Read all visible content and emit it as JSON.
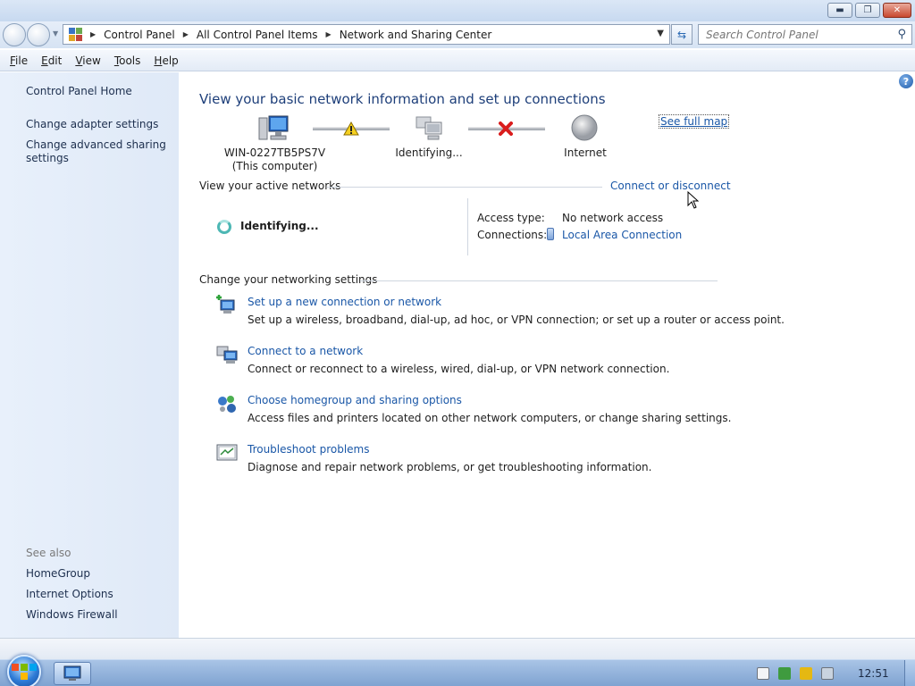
{
  "address_bar": {
    "breadcrumbs": [
      "Control Panel",
      "All Control Panel Items",
      "Network and Sharing Center"
    ],
    "search_placeholder": "Search Control Panel"
  },
  "menu": [
    "File",
    "Edit",
    "View",
    "Tools",
    "Help"
  ],
  "sidebar": {
    "home": "Control Panel Home",
    "links": [
      "Change adapter settings",
      "Change advanced sharing settings"
    ],
    "see_also_heading": "See also",
    "see_also": [
      "HomeGroup",
      "Internet Options",
      "Windows Firewall"
    ]
  },
  "main": {
    "title": "View your basic network information and set up connections",
    "see_full_map": "See full map",
    "network_map": {
      "computer_name": "WIN-0227TB5PS7V",
      "computer_note": "(This computer)",
      "middle_node": "Identifying...",
      "internet_node": "Internet"
    },
    "active_networks": {
      "heading": "View your active networks",
      "connect_link": "Connect or disconnect",
      "status": "Identifying...",
      "access_type_label": "Access type:",
      "access_type_value": "No network access",
      "connections_label": "Connections:",
      "connections_value": "Local Area Connection"
    },
    "settings": {
      "heading": "Change your networking settings",
      "tasks": [
        {
          "link": "Set up a new connection or network",
          "desc": "Set up a wireless, broadband, dial-up, ad hoc, or VPN connection; or set up a router or access point."
        },
        {
          "link": "Connect to a network",
          "desc": "Connect or reconnect to a wireless, wired, dial-up, or VPN network connection."
        },
        {
          "link": "Choose homegroup and sharing options",
          "desc": "Access files and printers located on other network computers, or change sharing settings."
        },
        {
          "link": "Troubleshoot problems",
          "desc": "Diagnose and repair network problems, or get troubleshooting information."
        }
      ]
    }
  },
  "taskbar": {
    "clock": "12:51"
  }
}
